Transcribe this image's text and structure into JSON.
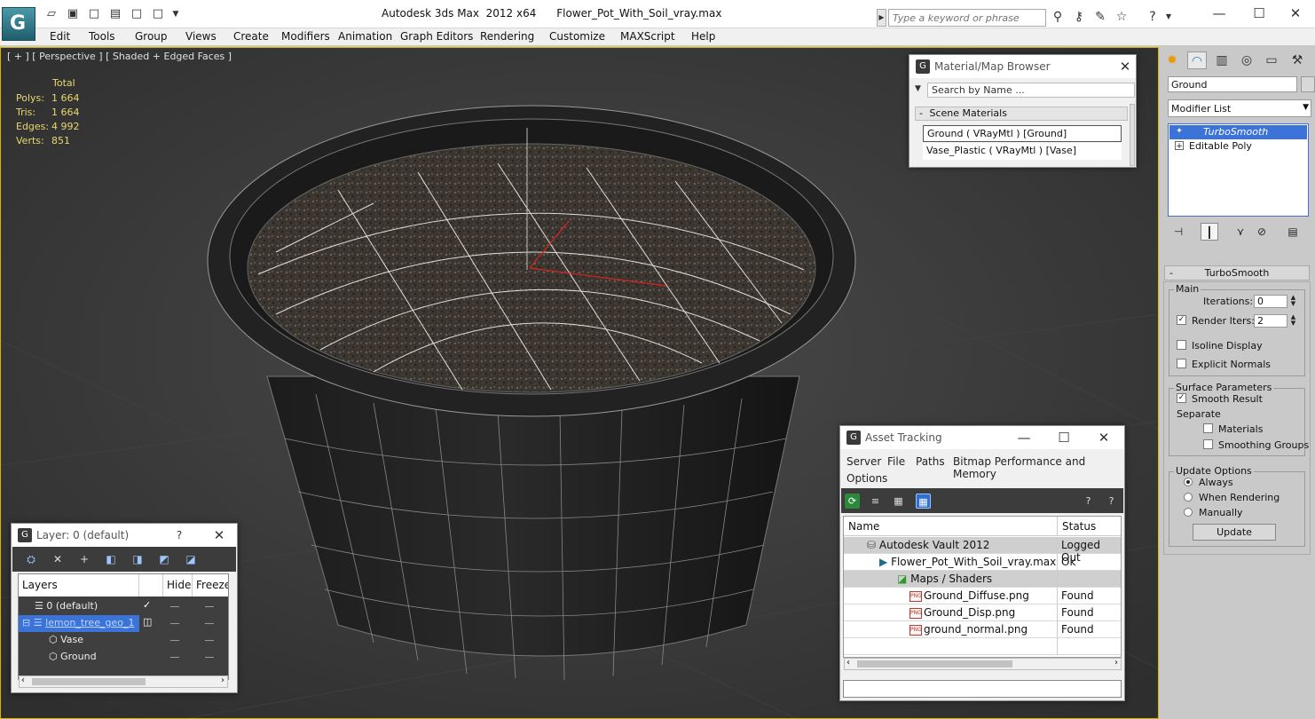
{
  "titlebar": {
    "app_name": "Autodesk 3ds Max  2012 x64",
    "file_name": "Flower_Pot_With_Soil_vray.max",
    "search_placeholder": "Type a keyword or phrase"
  },
  "menu": [
    "Edit",
    "Tools",
    "Group",
    "Views",
    "Create",
    "Modifiers",
    "Animation",
    "Graph Editors",
    "Rendering",
    "Customize",
    "MAXScript",
    "Help"
  ],
  "viewport": {
    "label": "[ + ] [ Perspective ] [ Shaded + Edged Faces ]",
    "stats_header": "Total",
    "stats": [
      {
        "label": "Polys:",
        "value": "1 664"
      },
      {
        "label": "Tris:",
        "value": "1 664"
      },
      {
        "label": "Edges:",
        "value": "4 992"
      },
      {
        "label": "Verts:",
        "value": "851"
      }
    ]
  },
  "material_browser": {
    "title": "Material/Map Browser",
    "search_placeholder": "Search by Name ...",
    "section": "Scene Materials",
    "section_toggle": "-",
    "materials": [
      "Ground  ( VRayMtl )  [Ground]",
      "Vase_Plastic  ( VRayMtl )  [Vase]"
    ]
  },
  "asset_tracking": {
    "title": "Asset Tracking",
    "menu": [
      "Server",
      "File",
      "Paths",
      "Bitmap Performance and Memory",
      "Options"
    ],
    "columns": [
      "Name",
      "Status"
    ],
    "png_badge": "PNG",
    "rows": [
      {
        "name": "Autodesk Vault 2012",
        "status": "Logged Out"
      },
      {
        "name": "Flower_Pot_With_Soil_vray.max",
        "status": "Ok"
      },
      {
        "name": "Maps / Shaders",
        "status": ""
      },
      {
        "name": "Ground_Diffuse.png",
        "status": "Found"
      },
      {
        "name": "Ground_Disp.png",
        "status": "Found"
      },
      {
        "name": "ground_normal.png",
        "status": "Found"
      }
    ]
  },
  "layer_window": {
    "title": "Layer: 0 (default)",
    "help": "?",
    "columns": [
      "Layers",
      "Hide",
      "Freeze"
    ],
    "rows": [
      {
        "name": "0 (default)"
      },
      {
        "name": "lemon_tree_geo_1"
      },
      {
        "name": "Vase"
      },
      {
        "name": "Ground"
      }
    ]
  },
  "command_panel": {
    "object_name": "Ground",
    "modifier_list": "Modifier List",
    "stack": [
      "TurboSmooth",
      "Editable Poly"
    ],
    "rollout_title": "TurboSmooth",
    "rollout_toggle": "-",
    "main_group": "Main",
    "iterations_label": "Iterations:",
    "iterations_value": "0",
    "render_iters_label": "Render Iters:",
    "render_iters_value": "2",
    "isoline_label": "Isoline Display",
    "explicit_normals_label": "Explicit Normals",
    "surface_group": "Surface Parameters",
    "smooth_result_label": "Smooth Result",
    "separate_label": "Separate",
    "materials_label": "Materials",
    "smoothing_groups_label": "Smoothing Groups",
    "update_group": "Update Options",
    "always_label": "Always",
    "when_rendering_label": "When Rendering",
    "manually_label": "Manually",
    "update_button": "Update"
  },
  "colors": {
    "viewport_bg": "#3a3a3a",
    "active_border": "#d7b400",
    "selection_blue": "#3b73d9",
    "stats_text": "#e8d870"
  }
}
